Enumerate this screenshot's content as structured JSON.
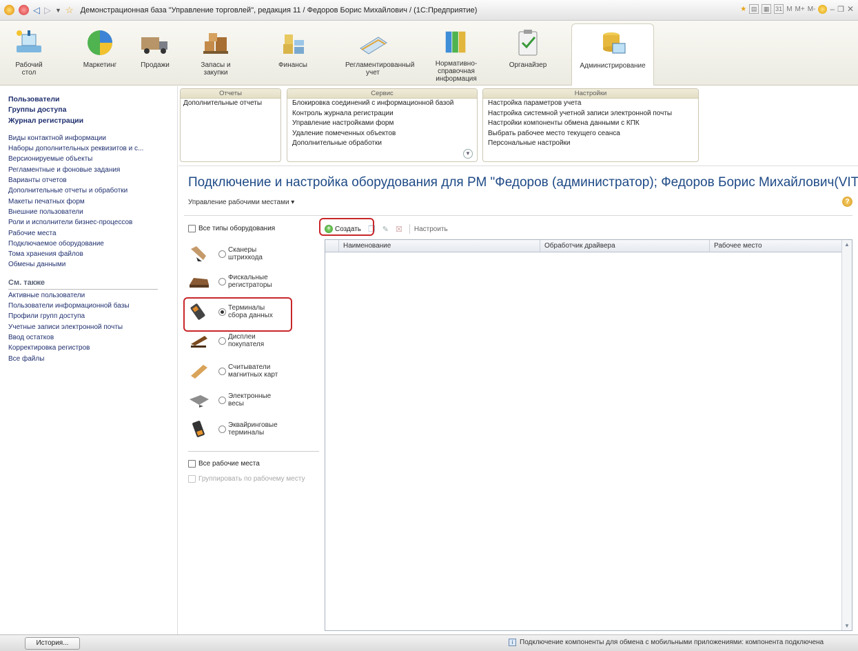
{
  "window": {
    "title": "Демонстрационная база \"Управление торговлей\", редакция 11 / Федоров Борис Михайлович / (1С:Предприятие)",
    "title_buttons": [
      "M",
      "M+",
      "M-"
    ]
  },
  "sections": [
    {
      "label": "Рабочий стол",
      "icon": "desktop-icon"
    },
    {
      "label": "Маркетинг",
      "icon": "pie-chart-icon"
    },
    {
      "label": "Продажи",
      "icon": "truck-icon"
    },
    {
      "label": "Запасы и закупки",
      "icon": "boxes-icon"
    },
    {
      "label": "Финансы",
      "icon": "coins-icon"
    },
    {
      "label": "Регламентированный учет",
      "icon": "books-icon"
    },
    {
      "label": "Нормативно-справочная информация",
      "icon": "binders-icon"
    },
    {
      "label": "Органайзер",
      "icon": "clipboard-icon"
    },
    {
      "label": "Администрирование",
      "icon": "database-icon",
      "active": true
    }
  ],
  "sidebar": {
    "bold_items": [
      "Пользователи",
      "Группы доступа",
      "Журнал регистрации"
    ],
    "items": [
      "Виды контактной информации",
      "Наборы дополнительных реквизитов и с...",
      "Версионируемые объекты",
      "Регламентные и фоновые задания",
      "Варианты отчетов",
      "Дополнительные отчеты и обработки",
      "Макеты печатных форм",
      "Внешние пользователи",
      "Роли и исполнители бизнес-процессов",
      "Рабочие места",
      "Подключаемое оборудование",
      "Тома хранения файлов",
      "Обмены данными"
    ],
    "see_also_header": "См. также",
    "see_also": [
      "Активные пользователи",
      "Пользователи информационной базы",
      "Профили групп доступа",
      "Учетные записи электронной почты",
      "Ввод остатков",
      "Корректировка регистров",
      "Все файлы"
    ]
  },
  "panels": {
    "reports": {
      "title": "Отчеты",
      "items": [
        "Дополнительные отчеты"
      ]
    },
    "service": {
      "title": "Сервис",
      "items": [
        "Блокировка соединений с информационной базой",
        "Контроль журнала регистрации",
        "Управление настройками форм",
        "Удаление помеченных объектов",
        "Дополнительные обработки"
      ]
    },
    "settings": {
      "title": "Настройки",
      "items": [
        "Настройка параметров учета",
        "Настройка системной учетной записи электронной почты",
        "Настройки компоненты обмена данными с КПК",
        "Выбрать рабочее место текущего сеанса",
        "Персональные настройки"
      ]
    }
  },
  "main": {
    "title": "Подключение и настройка оборудования для РМ \"Федоров (администратор); Федоров Борис Михайлович(VIT)\"",
    "workplaces_menu": "Управление рабочими местами ▾",
    "all_types_label": "Все типы оборудования",
    "device_types": [
      {
        "label1": "Сканеры",
        "label2": "штрихкода",
        "icon": "barcode-scanner-icon",
        "selected": false
      },
      {
        "label1": "Фискальные",
        "label2": "регистраторы",
        "icon": "fiscal-register-icon",
        "selected": false
      },
      {
        "label1": "Терминалы",
        "label2": "сбора данных",
        "icon": "data-terminal-icon",
        "selected": true
      },
      {
        "label1": "Дисплеи",
        "label2": "покупателя",
        "icon": "customer-display-icon",
        "selected": false
      },
      {
        "label1": "Считыватели",
        "label2": "магнитных карт",
        "icon": "card-reader-icon",
        "selected": false
      },
      {
        "label1": "Электронные",
        "label2": "весы",
        "icon": "scales-icon",
        "selected": false
      },
      {
        "label1": "Эквайринговые",
        "label2": "терминалы",
        "icon": "acquiring-terminal-icon",
        "selected": false
      }
    ],
    "all_workplaces_label": "Все рабочие места",
    "group_by_workplace_label": "Группировать по рабочему месту",
    "toolbar": {
      "create": "Создать",
      "configure": "Настроить"
    },
    "table_columns": [
      "Наименование",
      "Обработчик драйвера",
      "Рабочее место"
    ],
    "table_rows": []
  },
  "statusbar": {
    "history": "История...",
    "message": "Подключение компоненты для обмена с мобильными приложениями: компонента подключена"
  }
}
